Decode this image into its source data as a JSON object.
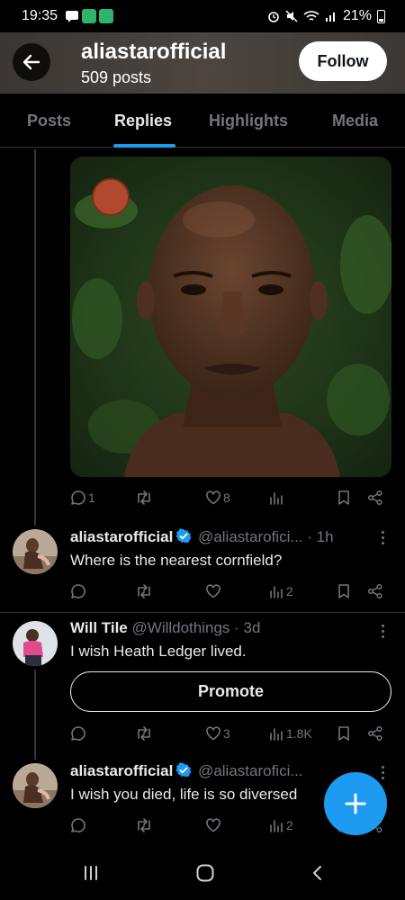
{
  "status_bar": {
    "time": "19:35",
    "battery": "21%"
  },
  "header": {
    "account_name": "aliastarofficial",
    "post_count": "509 posts",
    "follow_label": "Follow"
  },
  "tabs": [
    {
      "label": "Posts",
      "active": false
    },
    {
      "label": "Replies",
      "active": true
    },
    {
      "label": "Highlights",
      "active": false
    },
    {
      "label": "Media",
      "active": false
    }
  ],
  "image_post": {
    "replies": "1",
    "likes": "8"
  },
  "tweets": [
    {
      "name": "aliastarofficial",
      "handle": "@aliastarofici...",
      "time": "· 1h",
      "text": "Where is the nearest cornfield?",
      "views": "2"
    },
    {
      "name": "Will Tile",
      "handle": "@Willdothings",
      "time": "· 3d",
      "text": "I wish Heath Ledger lived.",
      "promote_label": "Promote",
      "likes": "3",
      "views": "1.8K"
    },
    {
      "name": "aliastarofficial",
      "handle": "@aliastarofici...",
      "time": "",
      "text": "I wish you died, life is so diversed",
      "views": "2"
    }
  ],
  "colors": {
    "accent": "#1d9bf0",
    "background": "#000000",
    "text_primary": "#e7e9ea",
    "text_secondary": "#71767b",
    "verified": "#1d9bf0"
  },
  "icons": [
    "back-arrow-icon",
    "reply-icon",
    "retweet-icon",
    "like-icon",
    "views-icon",
    "bookmark-icon",
    "share-icon",
    "verified-badge-icon",
    "more-icon",
    "plus-icon",
    "recent-apps-icon",
    "home-icon",
    "back-icon"
  ]
}
